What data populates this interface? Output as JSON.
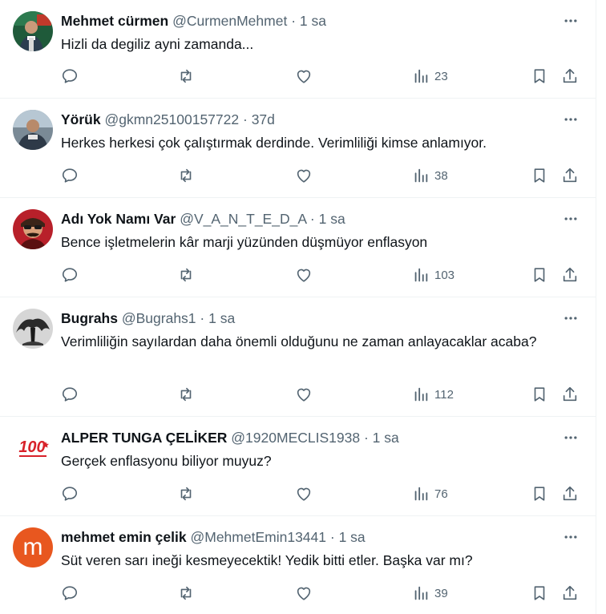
{
  "tweets": [
    {
      "name": "Mehmet cürmen",
      "handle": "@CurmenMehmet",
      "time": "1 sa",
      "text": "Hizli da degiliz ayni zamanda...",
      "views": "23"
    },
    {
      "name": "Yörük",
      "handle": "@gkmn25100157722",
      "time": "37d",
      "text": "Herkes herkesi çok çalıştırmak derdinde. Verimliliği kimse anlamıyor.",
      "views": "38"
    },
    {
      "name": "Adı Yok Namı Var",
      "handle": "@V_A_N_T_E_D_A",
      "time": "1 sa",
      "text": "Bence işletmelerin kâr marji yüzünden düşmüyor enflasyon",
      "views": "103"
    },
    {
      "name": "Bugrahs",
      "handle": "@Bugrahs1",
      "time": "1 sa",
      "text": "Verimliliğin sayılardan daha önemli olduğunu ne zaman anlayacaklar acaba?",
      "views": "112"
    },
    {
      "name": "ALPER TUNGA ÇELİKER",
      "handle": "@1920MECLIS1938",
      "time": "1 sa",
      "text": "Gerçek enflasyonu biliyor muyuz?",
      "views": "76",
      "avatar_text": "100"
    },
    {
      "name": "mehmet emin çelik",
      "handle": "@MehmetEmin13441",
      "time": "1 sa",
      "text": "Süt veren sarı ineği kesmeyecektik! Yedik bitti etler. Başka var mı?",
      "views": "39",
      "avatar_letter": "m"
    }
  ],
  "separator": "·",
  "colors": {
    "text": "#0f1419",
    "muted": "#536471",
    "divider": "#eff3f4",
    "avatar_m": "#e8571f",
    "red": "#d8222a"
  }
}
